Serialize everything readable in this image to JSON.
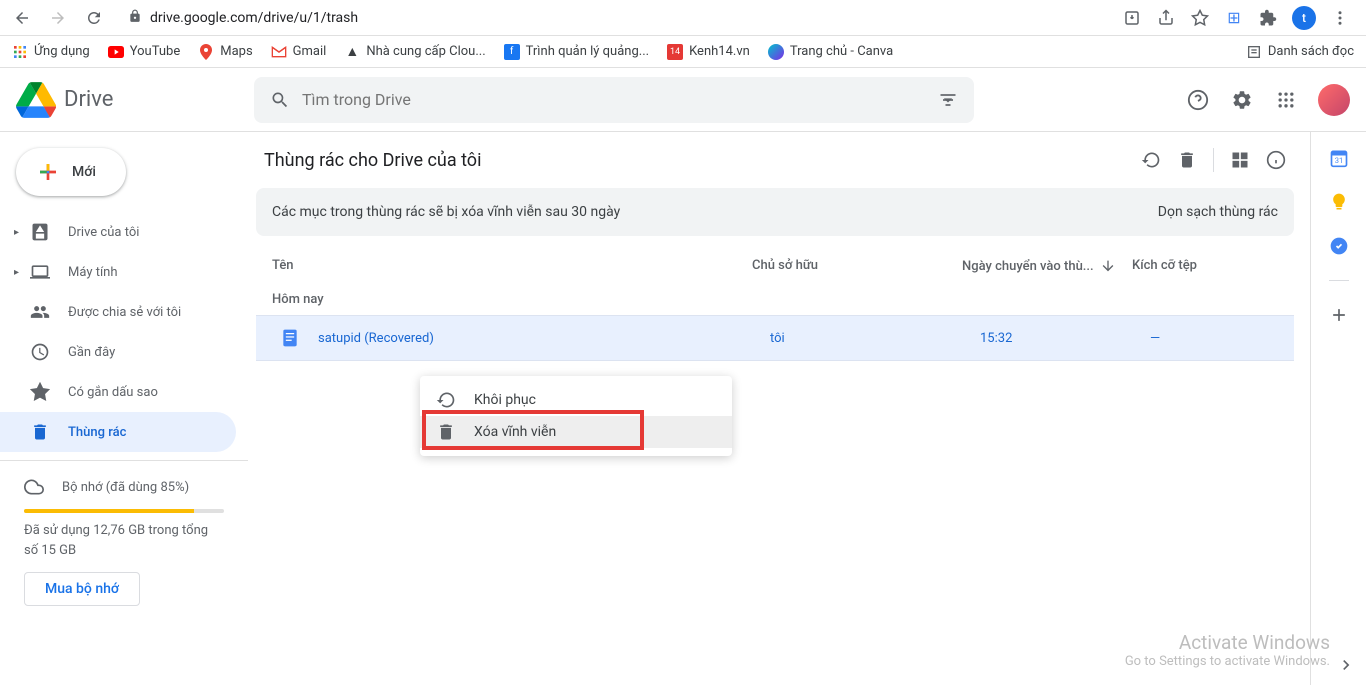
{
  "browser": {
    "url": "drive.google.com/drive/u/1/trash",
    "profile_letter": "t",
    "bookmarks": {
      "apps": "Ứng dụng",
      "youtube": "YouTube",
      "maps": "Maps",
      "gmail": "Gmail",
      "cloud": "Nhà cung cấp Clou...",
      "ads": "Trình quản lý quảng...",
      "kenh14": "Kenh14.vn",
      "canva": "Trang chủ - Canva",
      "reading_list": "Danh sách đọc"
    }
  },
  "header": {
    "logo_text": "Drive",
    "search_placeholder": "Tìm trong Drive"
  },
  "sidebar": {
    "new_label": "Mới",
    "items": {
      "my_drive": "Drive của tôi",
      "computers": "Máy tính",
      "shared": "Được chia sẻ với tôi",
      "recent": "Gần đây",
      "starred": "Có gắn dấu sao",
      "trash": "Thùng rác"
    },
    "storage": {
      "label": "Bộ nhớ (đã dùng 85%)",
      "text": "Đã sử dụng 12,76 GB trong tổng số 15 GB",
      "buy": "Mua bộ nhớ"
    }
  },
  "content": {
    "title": "Thùng rác cho Drive của tôi",
    "notice": "Các mục trong thùng rác sẽ bị xóa vĩnh viễn sau 30 ngày",
    "clear": "Dọn sạch thùng rác",
    "columns": {
      "name": "Tên",
      "owner": "Chủ sở hữu",
      "date": "Ngày chuyển vào thù...",
      "size": "Kích cỡ tệp"
    },
    "section": "Hôm nay",
    "row": {
      "name": "satupid (Recovered)",
      "owner": "tôi",
      "date": "15:32",
      "size": "—"
    }
  },
  "context_menu": {
    "restore": "Khôi phục",
    "delete": "Xóa vĩnh viễn"
  },
  "watermark": {
    "line1": "Activate Windows",
    "line2": "Go to Settings to activate Windows."
  }
}
